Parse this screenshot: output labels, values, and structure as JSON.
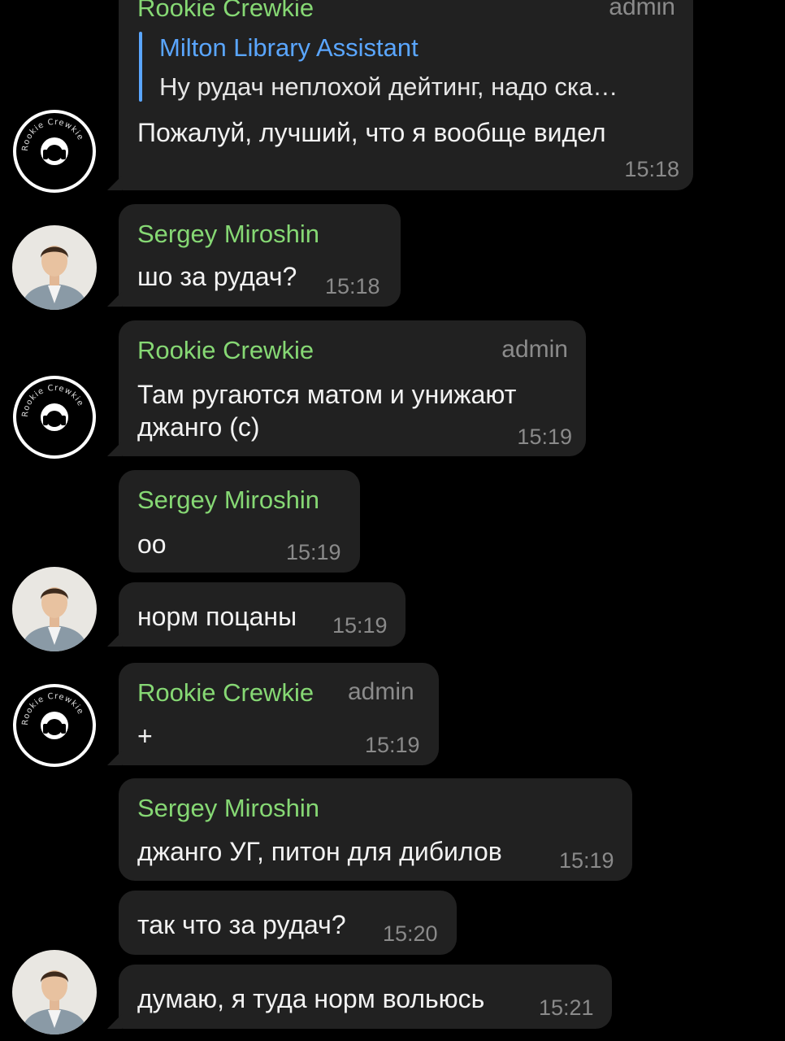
{
  "avatars": {
    "rookie_icon": "rookie-crewkie-logo-icon",
    "sergey_icon": "person-avatar-icon",
    "rookie_ring_text": "Rookie Crewkie"
  },
  "colors": {
    "background": "#000000",
    "bubble": "#212121",
    "sender_name": "#86d874",
    "reply_accent": "#5aa6ff",
    "meta_text": "#8a8a8a"
  },
  "messages": [
    {
      "sender": "Rookie Crewkie",
      "role": "admin",
      "reply_to": {
        "name": "Milton Library Assistant",
        "text": "Ну рудач неплохой дейтинг, надо ска…"
      },
      "text": "Пожалуй, лучший, что я вообще видел",
      "time": "15:18"
    },
    {
      "sender": "Sergey Miroshin",
      "text": "шо за рудач?",
      "time": "15:18"
    },
    {
      "sender": "Rookie Crewkie",
      "role": "admin",
      "text_line1": "Там ругаются матом и унижают",
      "text_line2": "джанго (с)",
      "time": "15:19"
    },
    {
      "sender": "Sergey Miroshin",
      "text": "оо",
      "time": "15:19"
    },
    {
      "text": "норм поцаны",
      "time": "15:19"
    },
    {
      "sender": "Rookie Crewkie",
      "role": "admin",
      "text": "+",
      "time": "15:19"
    },
    {
      "sender": "Sergey Miroshin",
      "text": "джанго УГ, питон для дибилов",
      "time": "15:19"
    },
    {
      "text": "так что за рудач?",
      "time": "15:20"
    },
    {
      "text": "думаю, я туда норм вольюсь",
      "time": "15:21"
    }
  ]
}
